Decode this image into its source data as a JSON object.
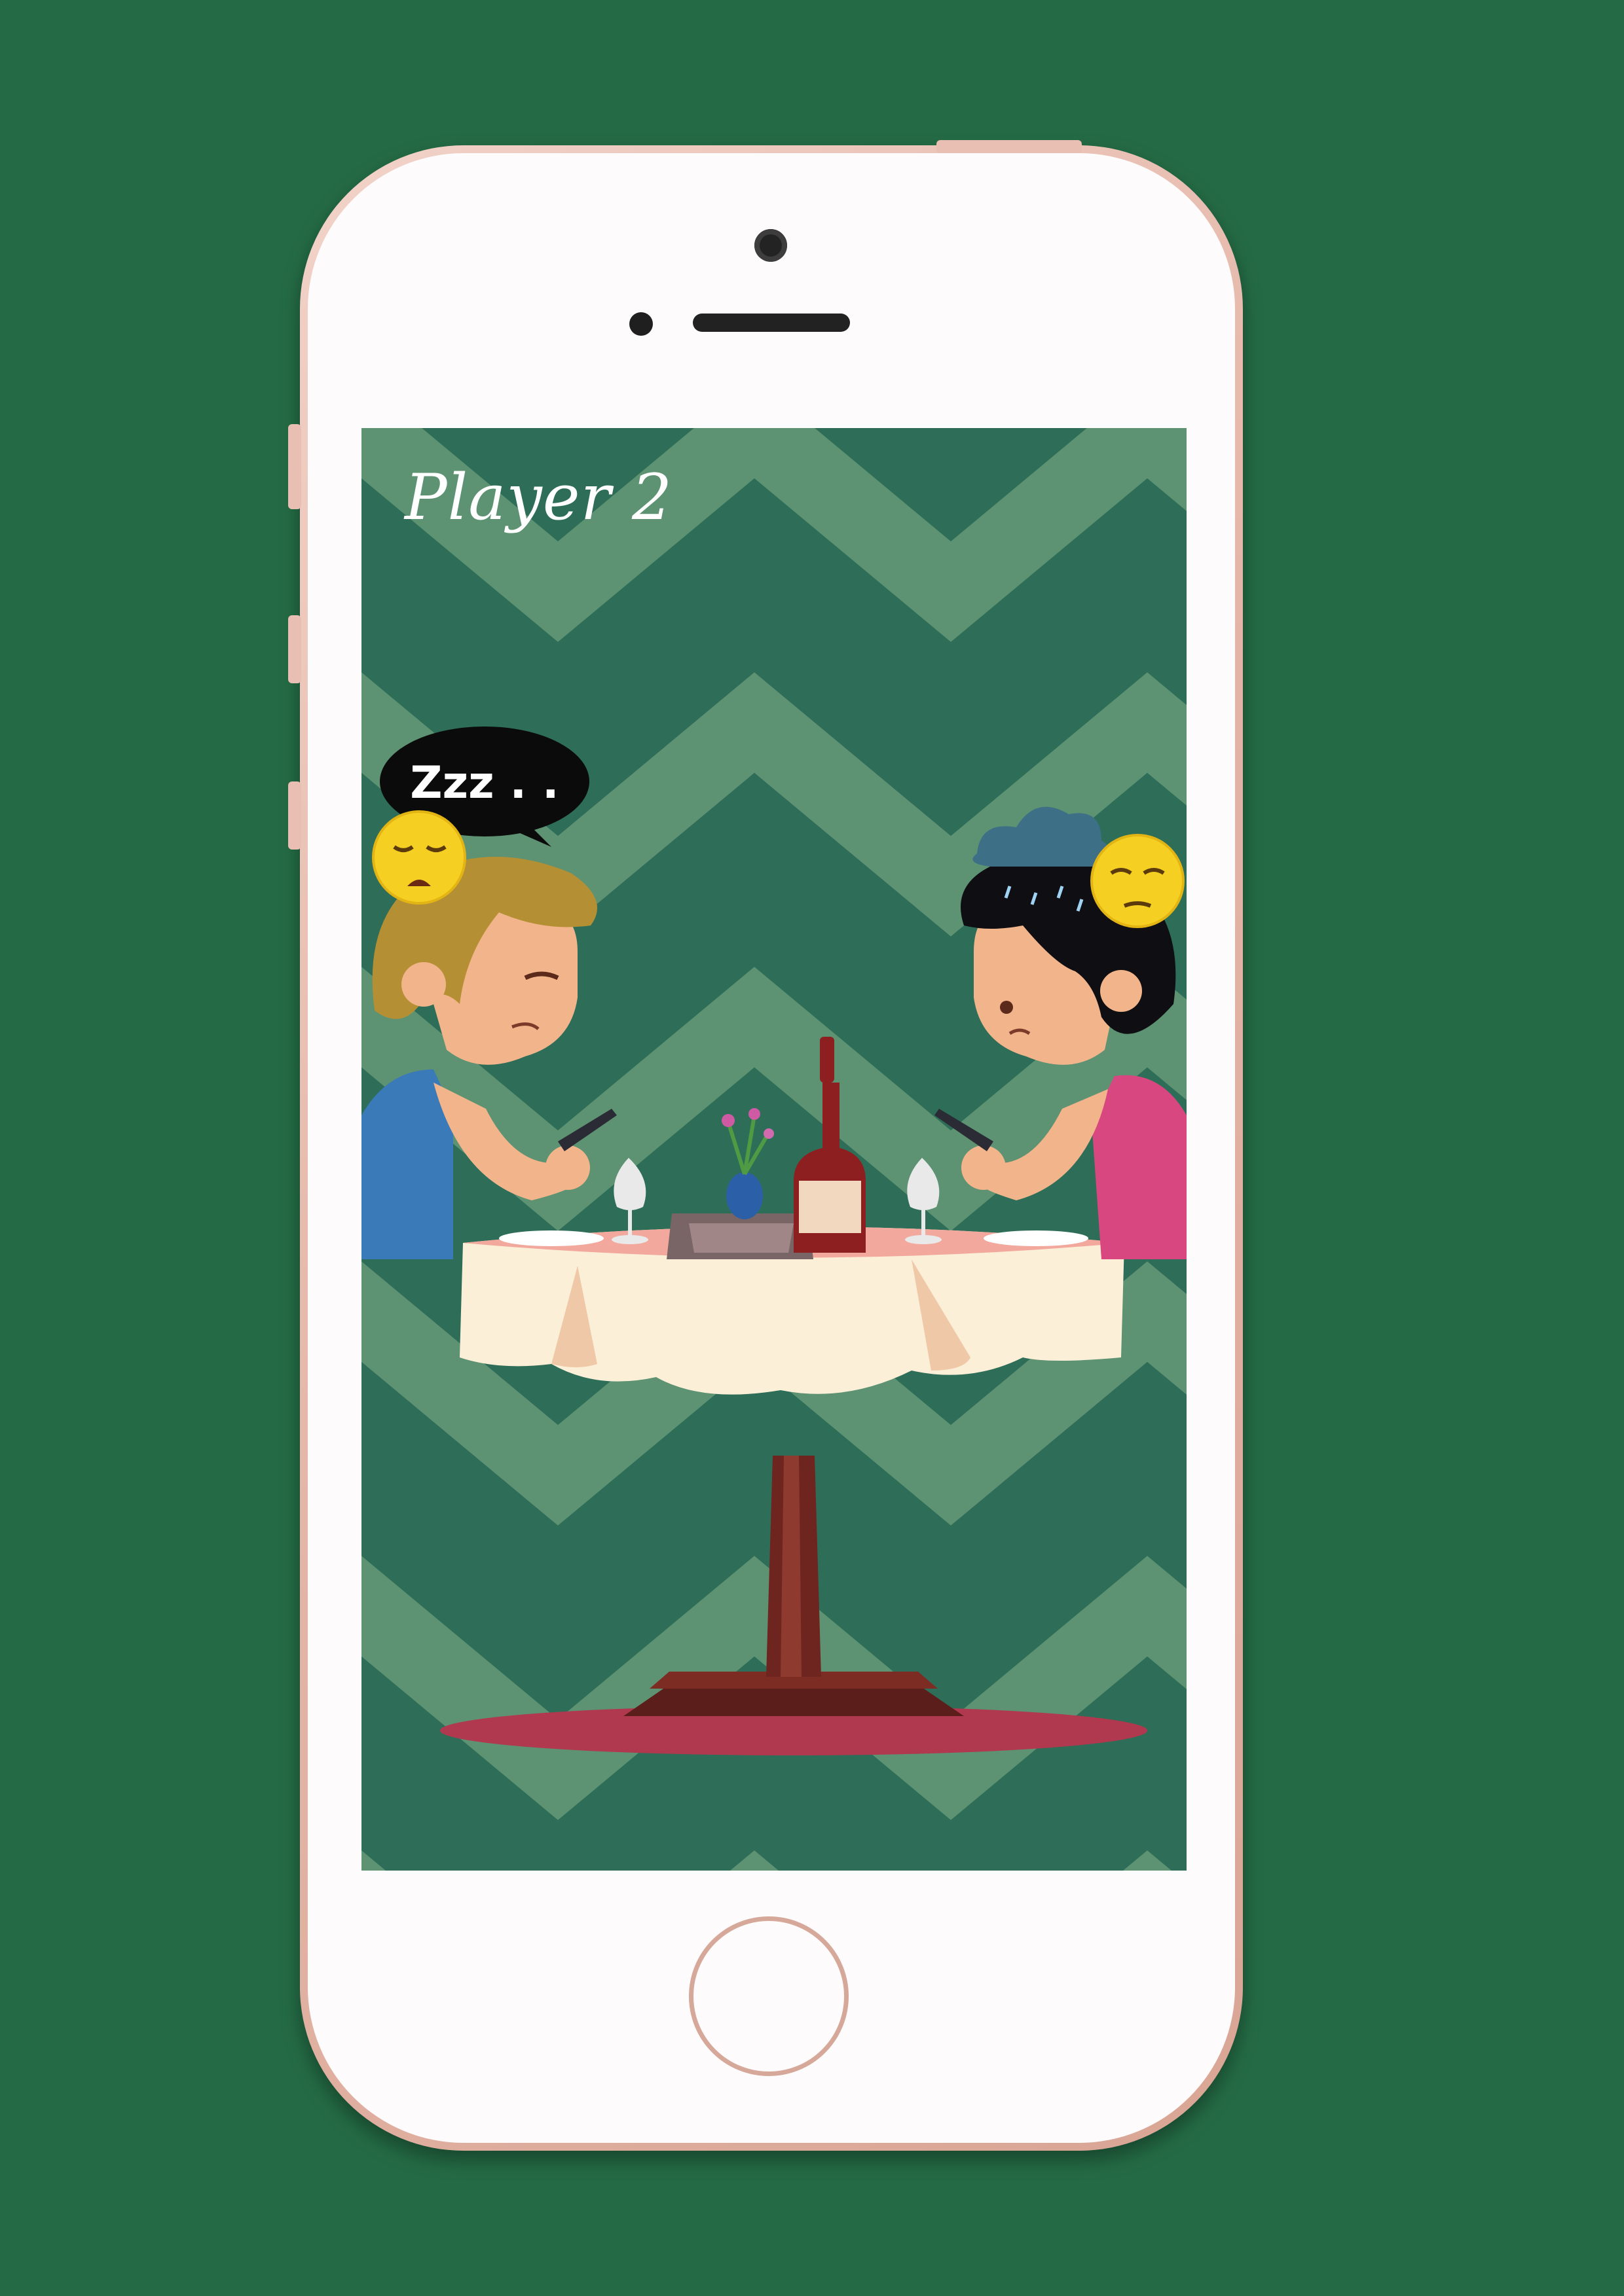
{
  "game": {
    "player_label": "Player 2",
    "speech_bubble_text": "Zzz . ."
  },
  "colors": {
    "background": "#246b45",
    "zigzag_dark": "#2e6e58",
    "zigzag_light": "#5d9272",
    "phone_frame": "#e3b4a6"
  },
  "icons": {
    "left_emoji": "sleepy-face-icon",
    "right_emoji": "sad-face-icon",
    "rain_cloud": "rain-cloud-icon"
  }
}
